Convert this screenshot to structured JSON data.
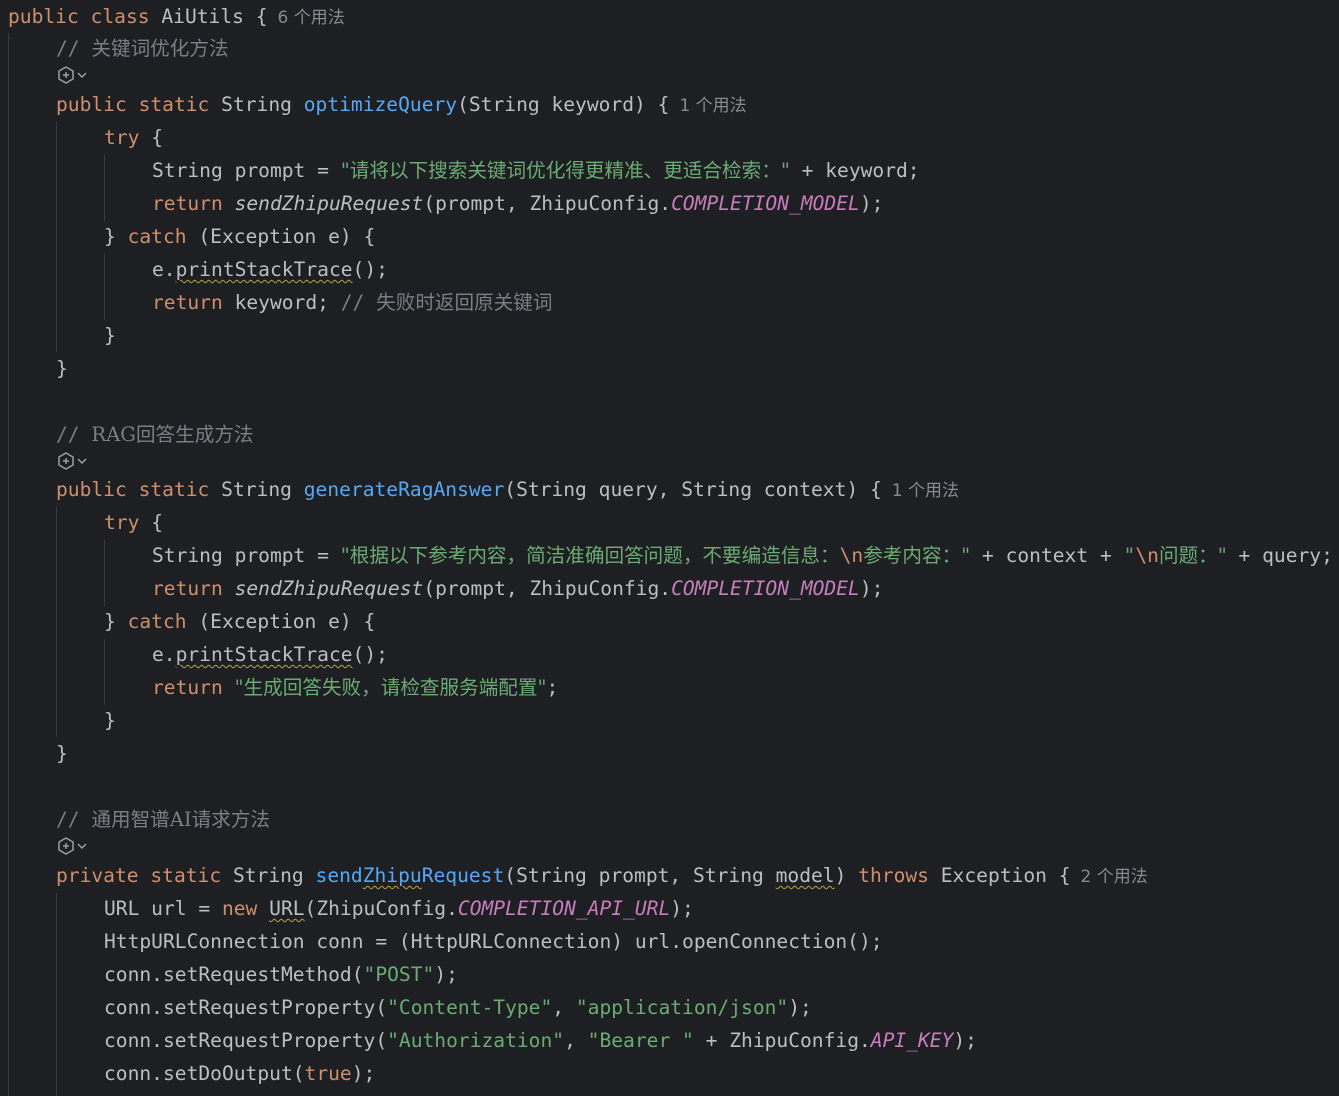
{
  "editor": {
    "colors": {
      "background": "#1e1f22",
      "keyword": "#cf8e6d",
      "function": "#56a8f5",
      "string": "#6aab73",
      "comment": "#7a7e85",
      "constant": "#c77dbb",
      "text": "#bcbec4",
      "hint": "#868a91"
    },
    "icons": {
      "ai_gutter": "ai-assistant-icon",
      "dropdown": "chevron-down-icon"
    },
    "class_decl": {
      "text": "public class AiUtils {",
      "usages": "6 个用法"
    },
    "m1": {
      "comment_prefix": "// ",
      "comment_text": "关键词优化方法",
      "sig": {
        "mods": "public static",
        "ret": "String",
        "name": "optimizeQuery",
        "params": "(String keyword) {",
        "usages": "1 个用法"
      },
      "try_kw": "try",
      "brace_open": "{",
      "l1": {
        "pre": "String prompt = ",
        "str": "\"请将以下搜索关键词优化得更精准、更适合检索：\"",
        "post": " + keyword;"
      },
      "l2": {
        "ret": "return",
        "fn": "sendZhipuRequest",
        "args": "(prompt, ZhipuConfig.",
        "const": "COMPLETION_MODEL",
        "end": ");"
      },
      "catch_pre": "} ",
      "catch_kw": "catch",
      "catch_rest": " (Exception e) {",
      "l3": {
        "obj": "e.",
        "method": "printStackTrace",
        "end": "();"
      },
      "l4": {
        "ret": "return",
        "text": " keyword; ",
        "cm": "// ",
        "cm_text": "失败时返回原关键词"
      },
      "close_inner": "}",
      "close_method": "}"
    },
    "m2": {
      "comment_prefix": "// ",
      "comment_text": "RAG回答生成方法",
      "sig": {
        "mods": "public static",
        "ret": "String",
        "name": "generateRagAnswer",
        "params": "(String query, String context) {",
        "usages": "1 个用法"
      },
      "try_kw": "try",
      "brace_open": "{",
      "l1": {
        "pre": "String prompt = ",
        "str1": "\"根据以下参考内容，简洁准确回答问题，不要编造信息：",
        "esc1": "\\n",
        "str1b": "参考内容：\"",
        "mid": " + context + ",
        "str2a": "\"",
        "esc2": "\\n",
        "str2b": "问题：\"",
        "post": " + query;"
      },
      "l2": {
        "ret": "return",
        "fn": "sendZhipuRequest",
        "args": "(prompt, ZhipuConfig.",
        "const": "COMPLETION_MODEL",
        "end": ");"
      },
      "catch_pre": "} ",
      "catch_kw": "catch",
      "catch_rest": " (Exception e) {",
      "l3": {
        "obj": "e.",
        "method": "printStackTrace",
        "end": "();"
      },
      "l4": {
        "ret": "return",
        "str": "\"生成回答失败，请检查服务端配置\"",
        "end": ";"
      },
      "close_inner": "}",
      "close_method": "}"
    },
    "m3": {
      "comment_prefix": "// ",
      "comment_text": "通用智谱AI请求方法",
      "sig": {
        "mods": "private static",
        "ret": "String",
        "name_a": "send",
        "name_b": "Zhipu",
        "name_c": "Request",
        "params_a": "(String prompt, String ",
        "param_model": "model",
        "params_b": ")",
        "throws_kw": "throws",
        "throws_rest": " Exception {",
        "usages": "2 个用法"
      },
      "l1": {
        "pre": "URL url = ",
        "new_kw": "new",
        "sp": " ",
        "cls": "URL",
        "args": "(ZhipuConfig.",
        "const": "COMPLETION_API_URL",
        "end": ");"
      },
      "l2": {
        "text": "HttpURLConnection conn = (HttpURLConnection) url.openConnection();"
      },
      "l3": {
        "pre": "conn.setRequestMethod(",
        "str": "\"POST\"",
        "end": ");"
      },
      "l4": {
        "pre": "conn.setRequestProperty(",
        "str1": "\"Content-Type\"",
        "mid": ", ",
        "str2": "\"application/json\"",
        "end": ");"
      },
      "l5": {
        "pre": "conn.setRequestProperty(",
        "str1": "\"Authorization\"",
        "mid": ", ",
        "str2": "\"Bearer \"",
        "post": " + ZhipuConfig.",
        "const": "API_KEY",
        "end": ");"
      },
      "l6": {
        "pre": "conn.setDoOutput(",
        "kw": "true",
        "end": ");"
      }
    }
  }
}
